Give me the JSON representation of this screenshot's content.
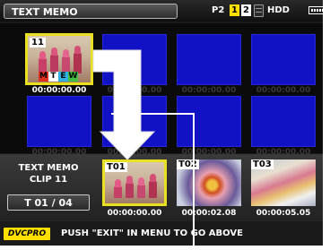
{
  "header": {
    "title": "TEXT MEMO",
    "media_label": "P2",
    "slots": [
      "1",
      "2"
    ],
    "drive_label": "HDD"
  },
  "grid": {
    "selected_clip": {
      "number": "11",
      "timecode": "00:00:00.00",
      "badges": [
        "M",
        "T",
        "E",
        "W"
      ]
    },
    "blank_timecode": "00:00:00.00"
  },
  "memo_panel": {
    "line1": "TEXT MEMO",
    "line2": "CLIP 11",
    "counter": "T 01 / 04"
  },
  "memo_thumbs": [
    {
      "label": "T01",
      "timecode": "00:00:00.00"
    },
    {
      "label": "T02",
      "timecode": "00:00:02.08"
    },
    {
      "label": "T03",
      "timecode": "00:00:05.05"
    }
  ],
  "status": {
    "format_badge": "DVCPRO",
    "message": "PUSH \"EXIT\" IN MENU TO GO ABOVE"
  },
  "colors": {
    "accent_yellow": "#e8e020",
    "tile_blue": "#1111c6",
    "badge_M": "#e03020",
    "badge_T": "#ffffff",
    "badge_E": "#30b0e0",
    "badge_W": "#40c040"
  }
}
